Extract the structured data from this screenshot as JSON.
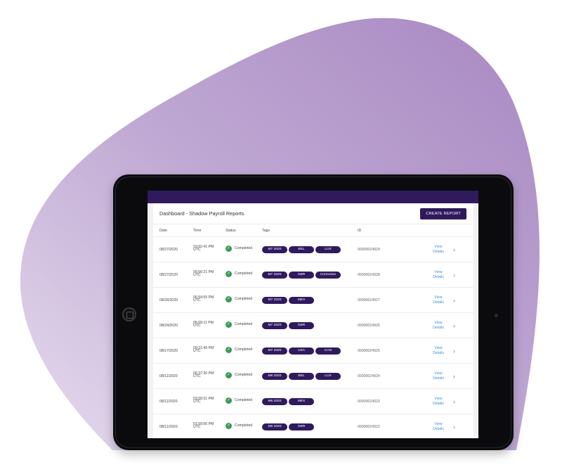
{
  "colors": {
    "accent": "#2f1a5e",
    "status_ok": "#3a9a53",
    "link": "#3d8fe0",
    "blob": "#b197c8"
  },
  "page": {
    "title": "Dashboard - Shadow Payroll Reports",
    "create_button": "CREATE REPORT"
  },
  "columns": {
    "date": "Date",
    "time": "Time",
    "status": "Status",
    "tags": "Tags",
    "id": "ID"
  },
  "rows": [
    {
      "date": "08/27/2020",
      "time": "10:02:41 PM",
      "tz": "UTC",
      "status": "Completed",
      "tags": [
        "M7 2020",
        "BEL",
        "LUX"
      ],
      "id": "00000024929",
      "view1": "View",
      "view2": "Details"
    },
    {
      "date": "08/27/2020",
      "time": "09:56:21 PM",
      "tz": "UTC",
      "status": "Completed",
      "tags": [
        "M7 2020",
        "GBR",
        "Correction"
      ],
      "id": "00000024928",
      "view1": "View",
      "view2": "Details"
    },
    {
      "date": "08/26/2020",
      "time": "06:54:55 PM",
      "tz": "UTC",
      "status": "Completed",
      "tags": [
        "M7 2020",
        "MEX"
      ],
      "id": "00000024927",
      "view1": "View",
      "view2": "Details"
    },
    {
      "date": "08/24/2020",
      "time": "06:09:11 PM",
      "tz": "UTC",
      "status": "Completed",
      "tags": [
        "M7 2020",
        "GBR"
      ],
      "id": "00000024926",
      "view1": "View",
      "view2": "Details"
    },
    {
      "date": "08/17/2020",
      "time": "09:21:49 PM",
      "tz": "UTC",
      "status": "Completed",
      "tags": [
        "M7 2020",
        "USA",
        "CAN"
      ],
      "id": "00000024925",
      "view1": "View",
      "view2": "Details"
    },
    {
      "date": "08/11/2020",
      "time": "06:37:36 PM",
      "tz": "UTC",
      "status": "Completed",
      "tags": [
        "M6 2020",
        "BEL",
        "LUX"
      ],
      "id": "00000024924",
      "view1": "View",
      "view2": "Details"
    },
    {
      "date": "08/11/2020",
      "time": "03:09:31 PM",
      "tz": "UTC",
      "status": "Completed",
      "tags": [
        "M6 2020",
        "MEX"
      ],
      "id": "00000024923",
      "view1": "View",
      "view2": "Details"
    },
    {
      "date": "08/11/2020",
      "time": "01:59:50 PM",
      "tz": "UTC",
      "status": "Completed",
      "tags": [
        "M6 2020",
        "GBR"
      ],
      "id": "00000024922",
      "view1": "View",
      "view2": "Details"
    }
  ],
  "icons": {
    "status": "check-circle-icon",
    "row_action": "chevron-right-icon",
    "home": "home-button-icon",
    "camera": "camera-icon"
  }
}
